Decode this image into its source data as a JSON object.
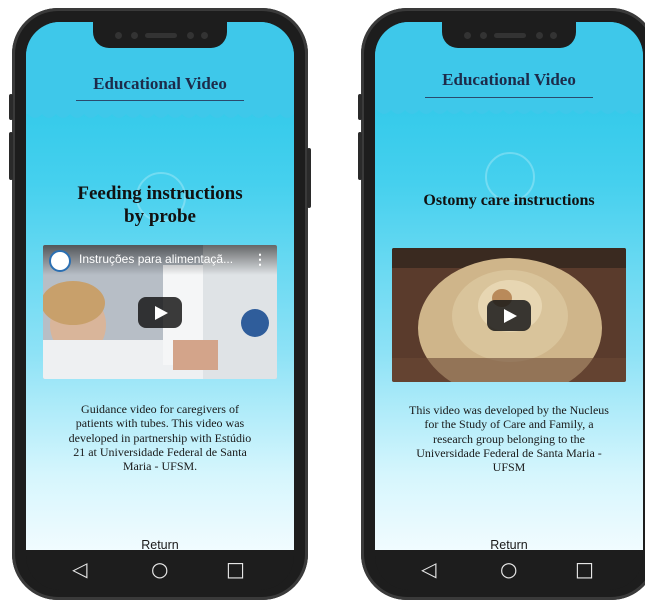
{
  "left_phone": {
    "header_title": "Educational Video",
    "video_title_line1": "Feeding instructions",
    "video_title_line2": "by probe",
    "video_overlay_title": "Instruções para alimentaçã...",
    "video_menu": "⋮",
    "description": [
      "Guidance video for caregivers of",
      "patients with tubes.  This video was",
      "developed in partnership with Estúdio",
      "21 at Universidade Federal de Santa",
      "Maria - UFSM."
    ],
    "return_label": "Return"
  },
  "right_phone": {
    "header_title": "Educational Video",
    "video_title": "Ostomy care instructions",
    "description": [
      "This video was developed by the Nucleus",
      "for the Study of Care and Family, a",
      "research group belonging to the",
      "Universidade Federal de Santa Maria -",
      "UFSM"
    ],
    "return_label": "Return"
  },
  "navbar": {
    "back_icon": "◁",
    "home_icon": "○",
    "recents_icon": "□"
  },
  "colors": {
    "header_blue": "#3ec8ea",
    "title_navy": "#1d2b4a",
    "phone_frame": "#1d1d1d"
  }
}
